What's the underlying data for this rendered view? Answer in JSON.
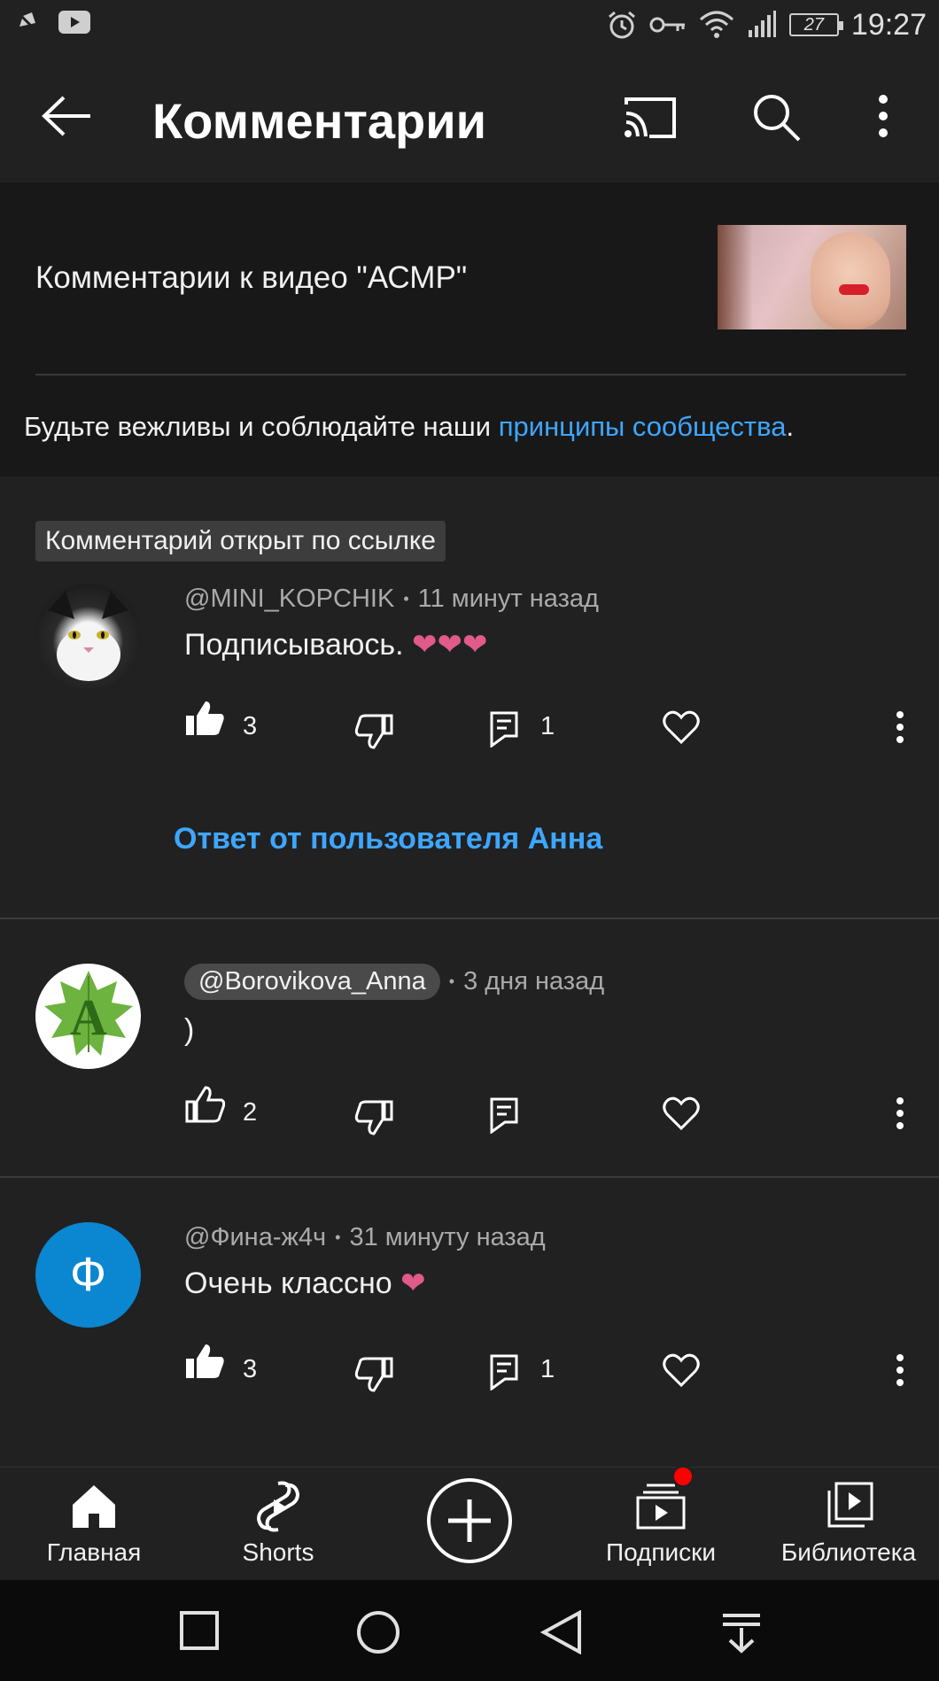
{
  "status_bar": {
    "time": "19:27",
    "battery": "27",
    "icons": [
      "notifications-off-icon",
      "youtube-icon",
      "alarm-icon",
      "key-icon",
      "wifi-icon",
      "signal-icon"
    ]
  },
  "app_bar": {
    "title": "Комментарии",
    "icons": [
      "back-arrow-icon",
      "cast-icon",
      "search-icon",
      "more-vert-icon"
    ]
  },
  "header": {
    "video_label": "Комментарии к видео \"АСМР\"",
    "guidelines_prefix": "Будьте вежливы и соблюдайте наши ",
    "guidelines_link": "принципы сообщества",
    "guidelines_suffix": "."
  },
  "linked_chip": "Комментарий открыт по ссылке",
  "comments": [
    {
      "author": "@MINI_KOPCHIK",
      "time": "11 минут назад",
      "text": "Подписываюсь. ",
      "emoji": "❤❤❤",
      "likes": "3",
      "replies": "1",
      "reply_link": "Ответ от пользователя Анна"
    },
    {
      "author": "@Borovikova_Anna",
      "time": "3 дня назад",
      "text": ")",
      "likes": "2",
      "avatar_letter": "A"
    },
    {
      "author": "@Фина-ж4ч",
      "time": "31 минуту назад",
      "text": "Очень классно ",
      "emoji": "❤",
      "likes": "3",
      "replies": "1",
      "avatar_letter": "Ф"
    }
  ],
  "bottom_nav": [
    {
      "label": "Главная",
      "icon": "home-icon"
    },
    {
      "label": "Shorts",
      "icon": "shorts-icon"
    },
    {
      "label": "",
      "icon": "create-plus-icon"
    },
    {
      "label": "Подписки",
      "icon": "subscriptions-icon"
    },
    {
      "label": "Библиотека",
      "icon": "library-icon"
    }
  ],
  "colors": {
    "background": "#212121",
    "panel": "#181818",
    "link": "#3ea6ff",
    "heart": "#e05a8a",
    "notification_dot": "#ff0000"
  }
}
